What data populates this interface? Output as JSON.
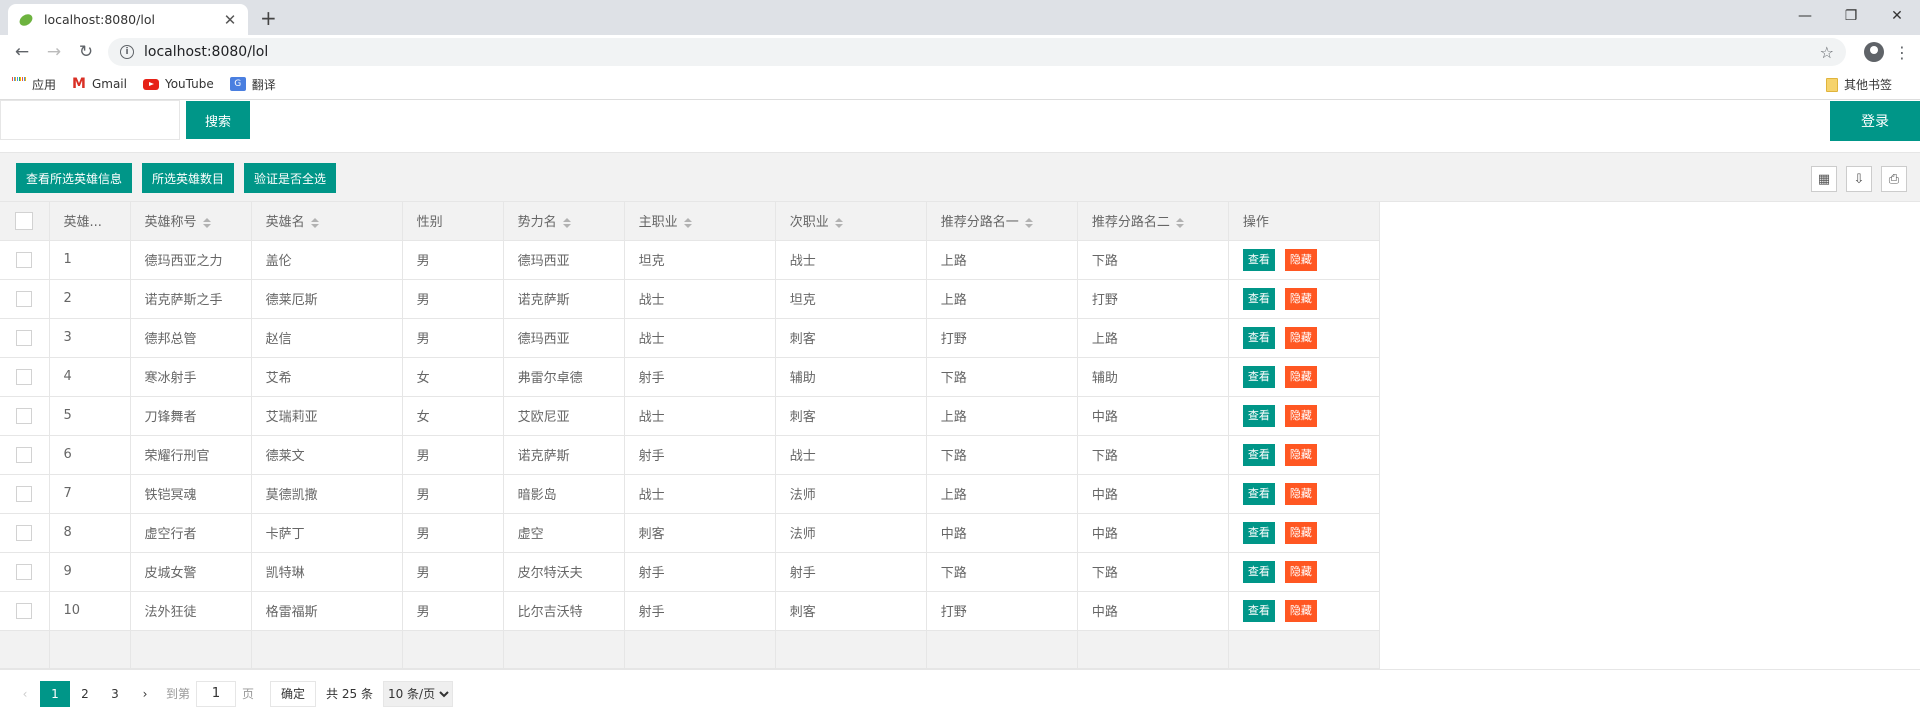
{
  "browser": {
    "tab_title": "localhost:8080/lol",
    "url": "localhost:8080/lol",
    "bookmarks": [
      "应用",
      "Gmail",
      "YouTube",
      "翻译"
    ],
    "other_bookmarks": "其他书签"
  },
  "search": {
    "button": "搜索",
    "login": "登录",
    "value": ""
  },
  "toolbar": {
    "btn1": "查看所选英雄信息",
    "btn2": "所选英雄数目",
    "btn3": "验证是否全选"
  },
  "table": {
    "headers": [
      "英雄...",
      "英雄称号",
      "英雄名",
      "性别",
      "势力名",
      "主职业",
      "次职业",
      "推荐分路名一",
      "推荐分路名二",
      "操作"
    ],
    "view_label": "查看",
    "hide_label": "隐藏",
    "rows": [
      [
        "1",
        "德玛西亚之力",
        "盖伦",
        "男",
        "德玛西亚",
        "坦克",
        "战士",
        "上路",
        "下路"
      ],
      [
        "2",
        "诺克萨斯之手",
        "德莱厄斯",
        "男",
        "诺克萨斯",
        "战士",
        "坦克",
        "上路",
        "打野"
      ],
      [
        "3",
        "德邦总管",
        "赵信",
        "男",
        "德玛西亚",
        "战士",
        "刺客",
        "打野",
        "上路"
      ],
      [
        "4",
        "寒冰射手",
        "艾希",
        "女",
        "弗雷尔卓德",
        "射手",
        "辅助",
        "下路",
        "辅助"
      ],
      [
        "5",
        "刀锋舞者",
        "艾瑞莉亚",
        "女",
        "艾欧尼亚",
        "战士",
        "刺客",
        "上路",
        "中路"
      ],
      [
        "6",
        "荣耀行刑官",
        "德莱文",
        "男",
        "诺克萨斯",
        "射手",
        "战士",
        "下路",
        "下路"
      ],
      [
        "7",
        "铁铠冥魂",
        "莫德凯撒",
        "男",
        "暗影岛",
        "战士",
        "法师",
        "上路",
        "中路"
      ],
      [
        "8",
        "虚空行者",
        "卡萨丁",
        "男",
        "虚空",
        "刺客",
        "法师",
        "中路",
        "中路"
      ],
      [
        "9",
        "皮城女警",
        "凯特琳",
        "男",
        "皮尔特沃夫",
        "射手",
        "射手",
        "下路",
        "下路"
      ],
      [
        "10",
        "法外狂徒",
        "格雷福斯",
        "男",
        "比尔吉沃特",
        "射手",
        "刺客",
        "打野",
        "中路"
      ]
    ]
  },
  "pager": {
    "pages": [
      "1",
      "2",
      "3"
    ],
    "goto": "到第",
    "page_value": "1",
    "page_unit": "页",
    "confirm": "确定",
    "total": "共 25 条",
    "per_page": "10 条/页"
  }
}
